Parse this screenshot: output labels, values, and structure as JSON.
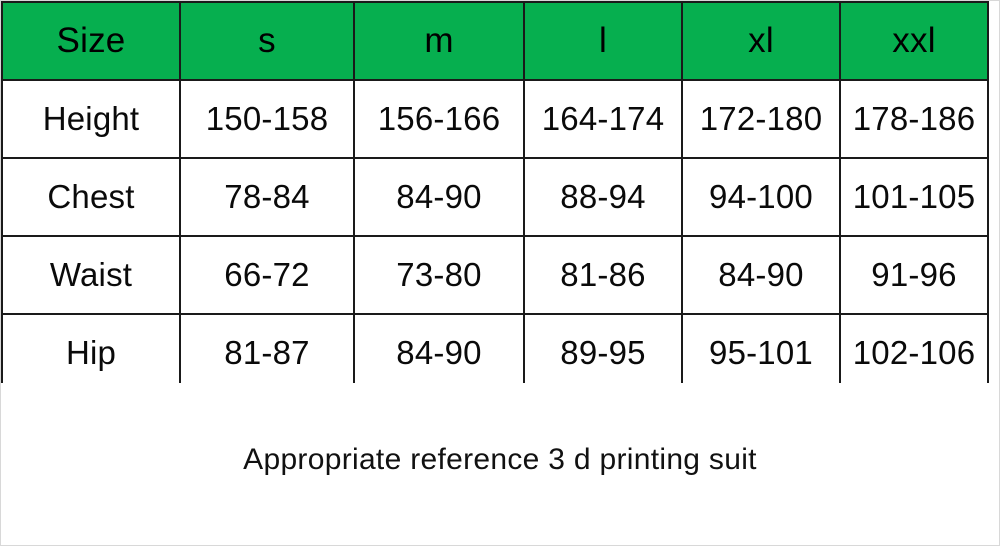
{
  "table": {
    "columns": [
      "Size",
      "s",
      "m",
      "l",
      "xl",
      "xxl"
    ],
    "header_background_color": "#06AF4F",
    "border_color": "#1a1a1a",
    "rows": [
      {
        "label": "Height",
        "values": [
          "150-158",
          "156-166",
          "164-174",
          "172-180",
          "178-186"
        ]
      },
      {
        "label": "Chest",
        "values": [
          "78-84",
          "84-90",
          "88-94",
          "94-100",
          "101-105"
        ]
      },
      {
        "label": "Waist",
        "values": [
          "66-72",
          "73-80",
          "81-86",
          "84-90",
          "91-96"
        ]
      },
      {
        "label": "Hip",
        "values": [
          "81-87",
          "84-90",
          "89-95",
          "95-101",
          "102-106"
        ]
      }
    ]
  },
  "caption": {
    "text": "Appropriate reference 3 d printing suit"
  }
}
